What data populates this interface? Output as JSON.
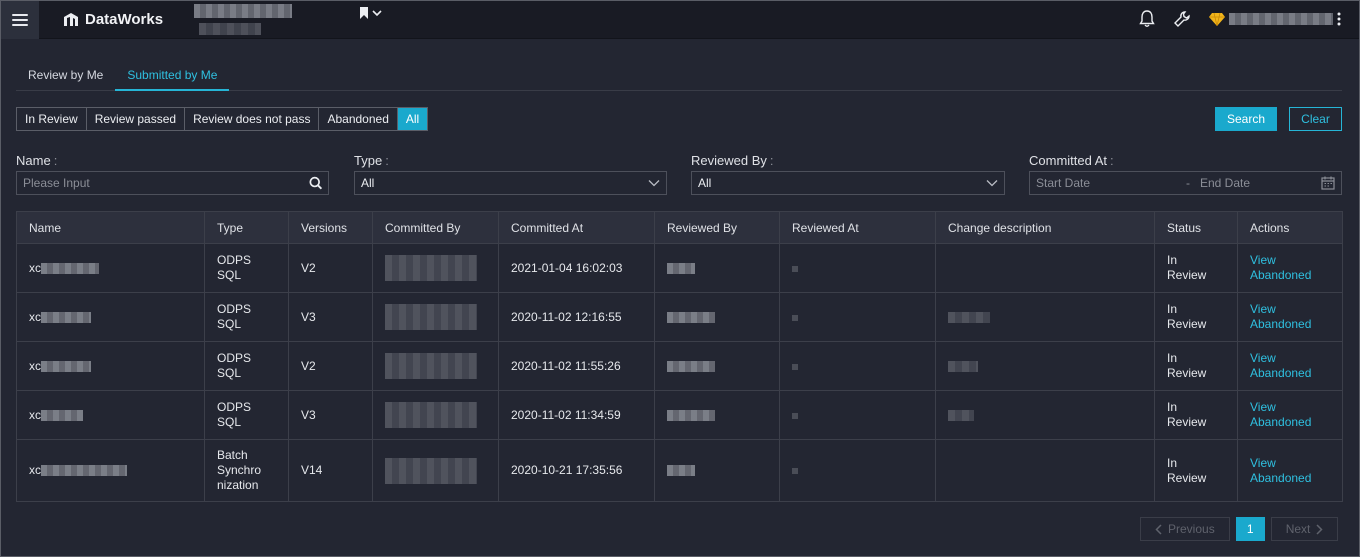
{
  "header": {
    "app_name": "DataWorks",
    "icons": [
      "menu-icon",
      "dataworks-logo-icon",
      "bookmark-icon",
      "chevron-down-icon",
      "bell-icon",
      "wrench-icon",
      "diamond-icon"
    ]
  },
  "tabs": [
    {
      "label": "Review by Me",
      "active": false
    },
    {
      "label": "Submitted by Me",
      "active": true
    }
  ],
  "status_filters": [
    {
      "label": "In Review",
      "active": false
    },
    {
      "label": "Review passed",
      "active": false
    },
    {
      "label": "Review does not pass",
      "active": false
    },
    {
      "label": "Abandoned",
      "active": false
    },
    {
      "label": "All",
      "active": true
    }
  ],
  "buttons": {
    "search": "Search",
    "clear": "Clear"
  },
  "form": {
    "name_label": "Name",
    "name_placeholder": "Please Input",
    "type_label": "Type",
    "type_value": "All",
    "reviewed_by_label": "Reviewed By",
    "reviewed_by_value": "All",
    "committed_at_label": "Committed At",
    "start_date_placeholder": "Start Date",
    "end_date_placeholder": "End Date",
    "date_separator": "-",
    "colon": ":"
  },
  "table": {
    "columns": [
      "Name",
      "Type",
      "Versions",
      "Committed By",
      "Committed At",
      "Reviewed By",
      "Reviewed At",
      "Change description",
      "Status",
      "Actions"
    ],
    "rows": [
      {
        "name": "xc",
        "type": [
          "ODPS",
          "SQL"
        ],
        "version": "V2",
        "committed_at": "2021-01-04 16:02:03",
        "status": [
          "In",
          "Review"
        ],
        "actions": [
          "View",
          "Abandoned"
        ]
      },
      {
        "name": "xc",
        "type": [
          "ODPS",
          "SQL"
        ],
        "version": "V3",
        "committed_at": "2020-11-02 12:16:55",
        "status": [
          "In",
          "Review"
        ],
        "actions": [
          "View",
          "Abandoned"
        ]
      },
      {
        "name": "xc",
        "type": [
          "ODPS",
          "SQL"
        ],
        "version": "V2",
        "committed_at": "2020-11-02 11:55:26",
        "status": [
          "In",
          "Review"
        ],
        "actions": [
          "View",
          "Abandoned"
        ]
      },
      {
        "name": "xc",
        "type": [
          "ODPS",
          "SQL"
        ],
        "version": "V3",
        "committed_at": "2020-11-02 11:34:59",
        "status": [
          "In",
          "Review"
        ],
        "actions": [
          "View",
          "Abandoned"
        ]
      },
      {
        "name": "xc",
        "type": [
          "Batch",
          "Synchro",
          "nization"
        ],
        "version": "V14",
        "committed_at": "2020-10-21 17:35:56",
        "status": [
          "In",
          "Review"
        ],
        "actions": [
          "View",
          "Abandoned"
        ]
      }
    ]
  },
  "pagination": {
    "previous": "Previous",
    "current": "1",
    "next": "Next"
  },
  "colors": {
    "accent": "#1aa9cd",
    "status_in_review": "#f08d1e",
    "background": "#232632",
    "header": "#191b24"
  }
}
